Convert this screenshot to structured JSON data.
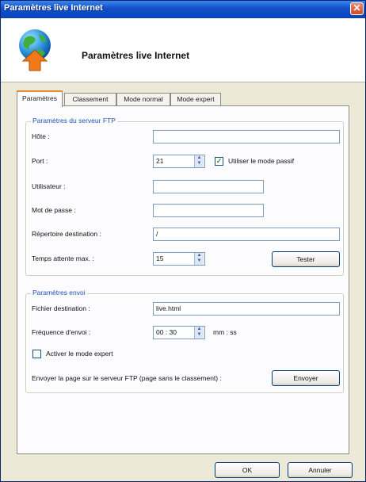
{
  "window": {
    "title": "Paramètres live Internet"
  },
  "header": {
    "title": "Paramètres live Internet",
    "icon": "globe-upload-icon"
  },
  "tabs": [
    {
      "label": "Paramètres",
      "active": true
    },
    {
      "label": "Classement",
      "active": false
    },
    {
      "label": "Mode normal",
      "active": false
    },
    {
      "label": "Mode expert",
      "active": false
    }
  ],
  "ftp": {
    "legend": "Paramètres du serveur FTP",
    "host_label": "Hôte :",
    "host_value": "",
    "port_label": "Port :",
    "port_value": "21",
    "passive_label": "Utiliser le mode passif",
    "passive_checked": true,
    "user_label": "Utilisateur :",
    "user_value": "",
    "password_label": "Mot de passe :",
    "password_value": "",
    "dir_label": "Répertoire destination :",
    "dir_value": "/",
    "timeout_label": "Temps attente max. :",
    "timeout_value": "15",
    "test_button": "Tester"
  },
  "send": {
    "legend": "Paramètres envoi",
    "file_label": "Fichier destination :",
    "file_value": "live.html",
    "freq_label": "Fréquence d'envoi :",
    "freq_value": "00 : 30",
    "freq_unit": "mm : ss",
    "expert_label": "Activer le mode expert",
    "expert_checked": false,
    "send_page_label": "Envoyer la page sur le serveur FTP (page sans le classement) :",
    "send_button": "Envoyer"
  },
  "footer": {
    "ok_button": "OK",
    "cancel_button": "Annuler"
  }
}
